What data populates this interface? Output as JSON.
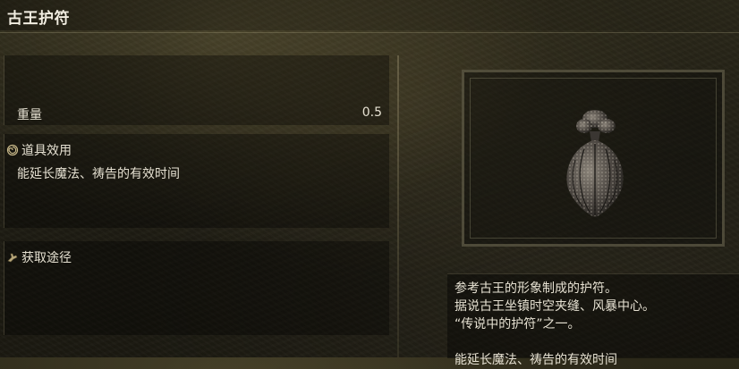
{
  "item": {
    "name": "古王护符"
  },
  "stats": {
    "weight_label": "重量",
    "weight_value": "0.5"
  },
  "effect": {
    "heading": "道具效用",
    "text": "能延长魔法、祷告的有效时间"
  },
  "acquire": {
    "heading": "获取途径"
  },
  "description": {
    "lines": [
      "参考古王的形象制成的护符。",
      "据说古王坐镇时空夹缝、风暴中心。",
      "“传说中的护符”之一。",
      "能延长魔法、祷告的有效时间"
    ]
  },
  "icons": {
    "effect": "swirl-icon",
    "acquire": "hand-icon",
    "item": "talisman-icon"
  }
}
